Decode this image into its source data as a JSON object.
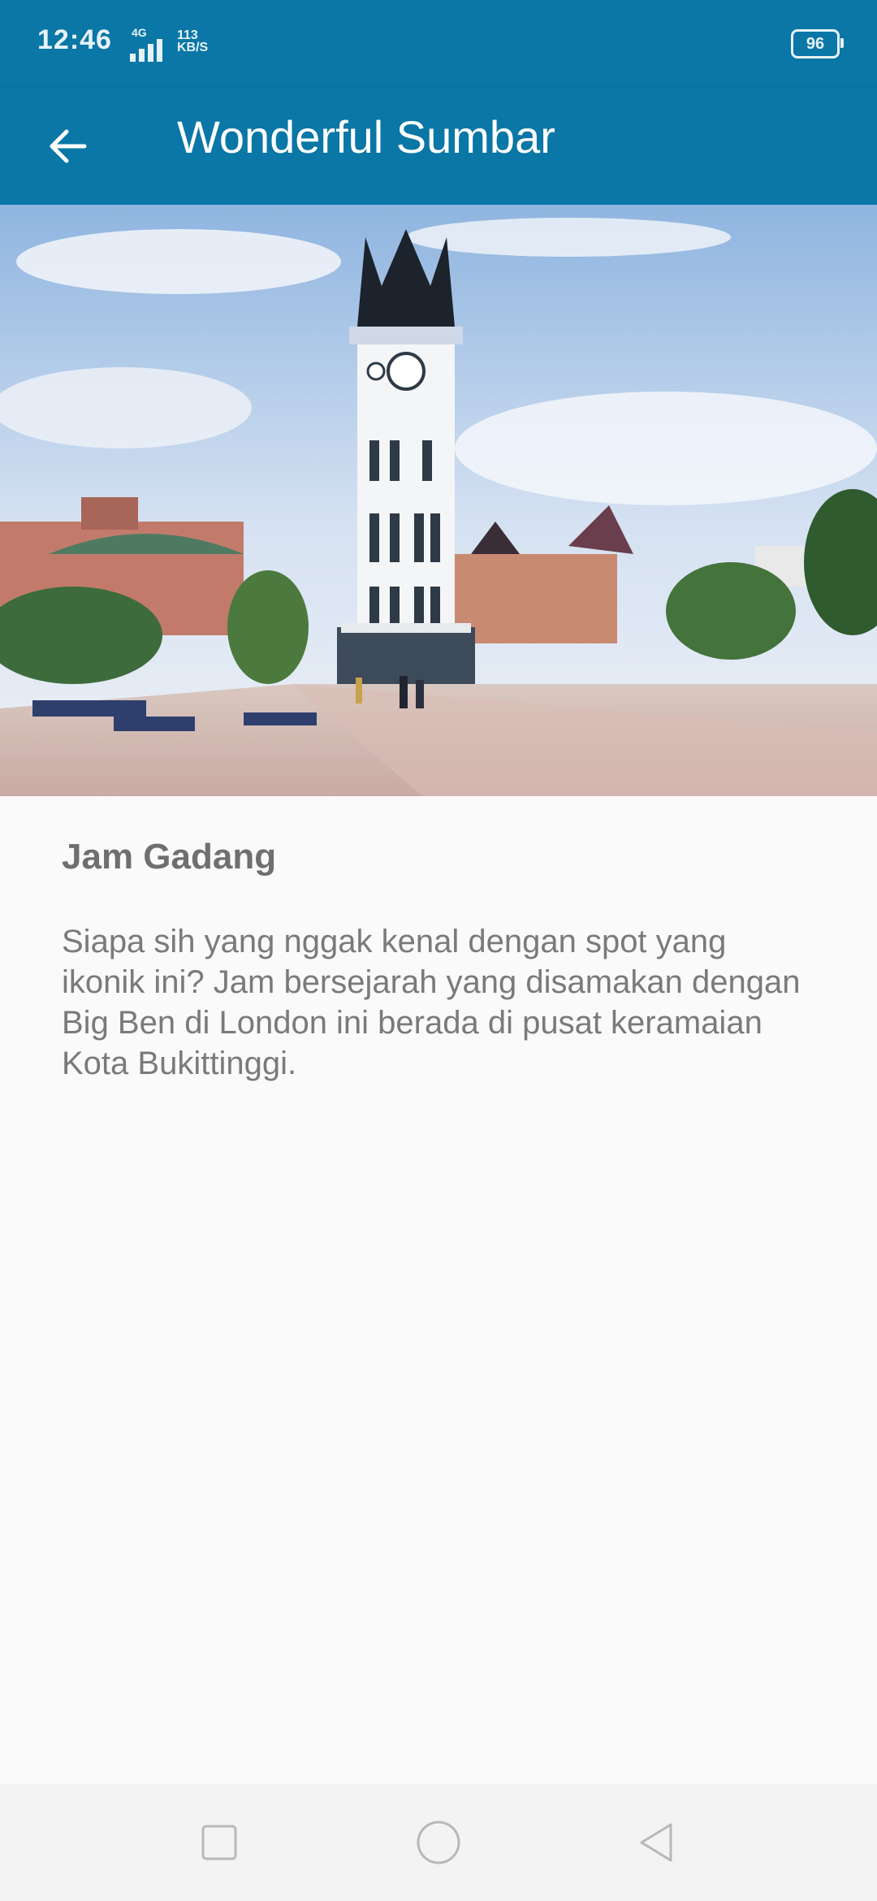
{
  "status_bar": {
    "time": "12:46",
    "network_type": "4G",
    "speed_value": "113",
    "speed_unit": "KB/S",
    "battery": "96",
    "icons": [
      "signal-icon",
      "battery-icon"
    ]
  },
  "app_bar": {
    "title": "Wonderful Sumbar",
    "back_icon": "arrow-left-icon",
    "background": "#0a77a6"
  },
  "detail": {
    "image_subject": "Jam Gadang clock tower",
    "name": "Jam Gadang",
    "description": "Siapa sih yang nggak kenal dengan spot yang ikonik ini? Jam bersejarah yang disamakan dengan Big Ben di London ini berada di pusat keramaian Kota Bukittinggi."
  },
  "nav_bar": {
    "buttons": [
      "square-icon",
      "circle-icon",
      "triangle-back-icon"
    ]
  }
}
